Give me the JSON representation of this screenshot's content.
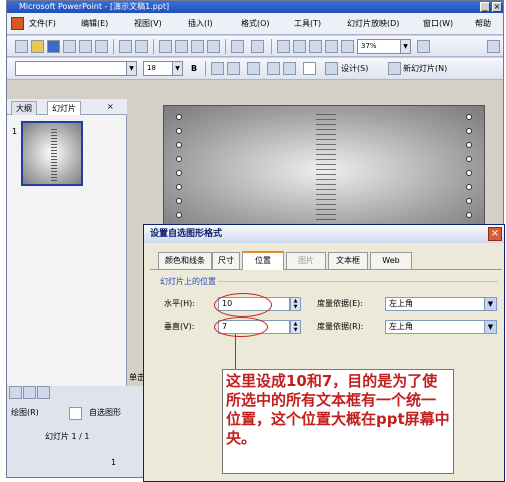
{
  "window": {
    "title": "Microsoft PowerPoint - [演示文稿1.ppt]",
    "min": "_",
    "close": "×"
  },
  "menu": [
    "文件(F)",
    "编辑(E)",
    "视图(V)",
    "插入(I)",
    "格式(O)",
    "工具(T)",
    "幻灯片放映(D)",
    "窗口(W)",
    "帮助"
  ],
  "toolbar1": {
    "zoom": "37%"
  },
  "toolbar2": {
    "font_size": "18",
    "bold": "B",
    "design": "设计(S)",
    "new_slide": "新幻灯片(N)"
  },
  "left_pane": {
    "tabs": [
      "大纲",
      "幻灯片"
    ],
    "close": "×",
    "slide_number": "1",
    "status": "幻灯片 1 / 1",
    "draw": "绘图(R)",
    "autoshape": "自选图形"
  },
  "dialog": {
    "title": "设置自选图形格式",
    "close": "×",
    "tabs": [
      "颜色和线条",
      "尺寸",
      "位置",
      "图片",
      "文本框",
      "Web"
    ],
    "active_tab": "位置",
    "section": "幻灯片上的位置",
    "horizontal_label": "水平(H):",
    "horizontal_value": "10",
    "vertical_label": "垂直(V):",
    "vertical_value": "7",
    "from_label_h": "度量依据(E):",
    "from_label_v": "度量依据(R):",
    "from_value_h": "左上角",
    "from_value_v": "左上角"
  },
  "annotation": "这里设成10和7，目的是为了使所选中的所有文本框有一个统一位置，这个位置大概在ppt屏幕中央。",
  "partial_text": "单击"
}
